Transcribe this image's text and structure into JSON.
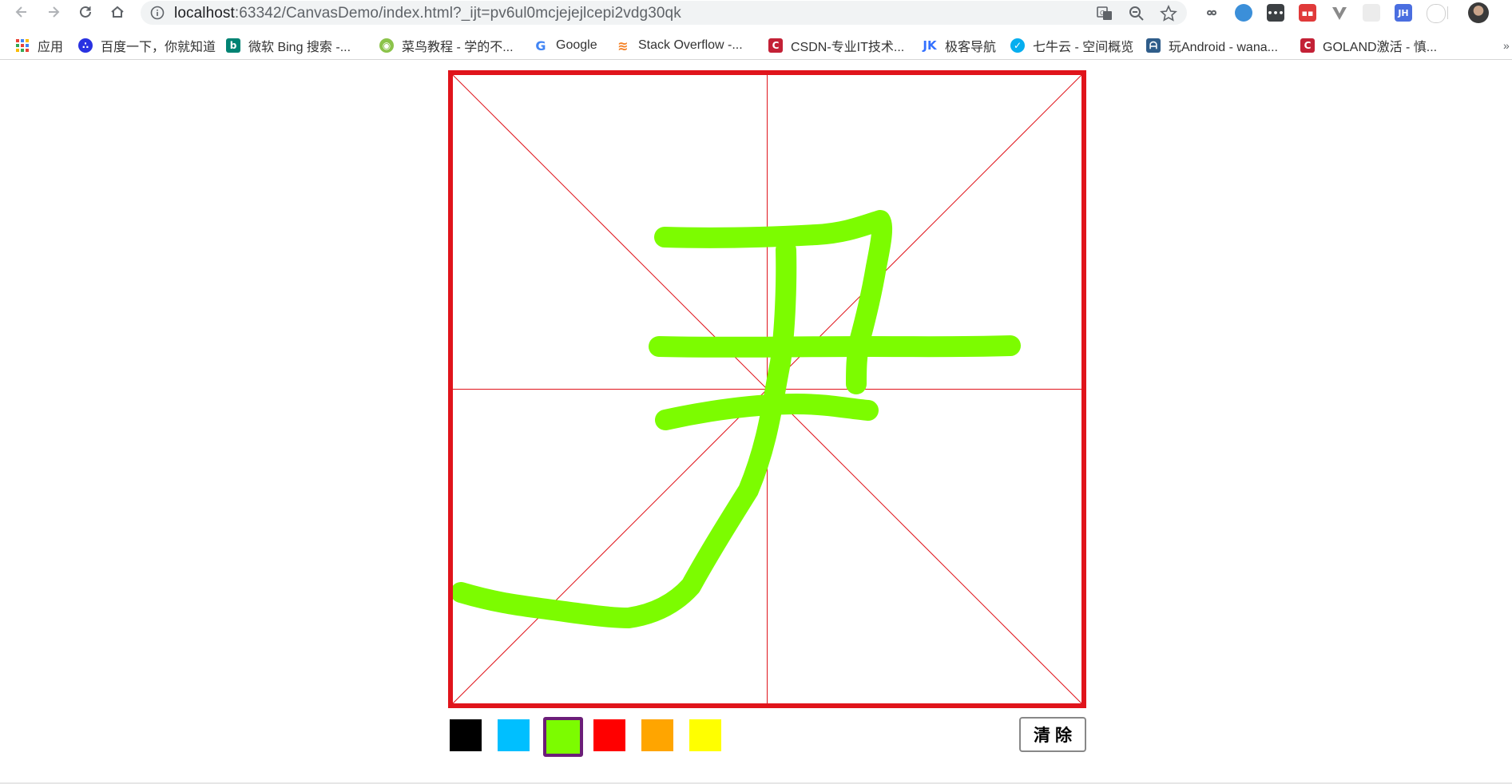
{
  "browser": {
    "url_host": "localhost",
    "url_rest": ":63342/CanvasDemo/index.html?_ijt=pv6ul0mcjejejlcepi2vdg30qk",
    "extensions": [
      {
        "name": "translate-icon"
      },
      {
        "name": "zoom-icon"
      },
      {
        "name": "bookmark-star-icon"
      },
      {
        "name": "infinity-extension-icon",
        "color": "#5f6368"
      },
      {
        "name": "wappalyzer-extension-icon",
        "color": "#3b8fd9"
      },
      {
        "name": "more-dots-extension-icon",
        "color": "#3c4043"
      },
      {
        "name": "red-extension-icon",
        "color": "#e03a3a"
      },
      {
        "name": "vue-extension-icon",
        "color": "#8a8a8a"
      },
      {
        "name": "blank-extension-icon",
        "color": "#dcdcdc"
      },
      {
        "name": "jh-extension-icon",
        "label": "JH",
        "color": "#4a6ee0"
      },
      {
        "name": "circle-extension-icon",
        "color": "#cfcfcf"
      },
      {
        "name": "profile-avatar",
        "color": "#555555"
      }
    ]
  },
  "bookmarks": [
    {
      "label": "应用",
      "icon": "apps-grid-icon",
      "color": "#ea4335"
    },
    {
      "label": "百度一下，你就知道",
      "icon": "baidu-paw-icon",
      "color": "#2932e1"
    },
    {
      "label": "微软 Bing 搜索 -...",
      "icon": "bing-icon",
      "color": "#008373"
    },
    {
      "label": "菜鸟教程 - 学的不...",
      "icon": "runoob-icon",
      "color": "#8bc34a"
    },
    {
      "label": "Google",
      "icon": "google-icon",
      "color": "#4285f4"
    },
    {
      "label": "Stack Overflow -...",
      "icon": "stackoverflow-icon",
      "color": "#f48024"
    },
    {
      "label": "CSDN-专业IT技术...",
      "icon": "csdn-icon",
      "color": "#c32136"
    },
    {
      "label": "极客导航",
      "icon": "jike-icon",
      "color": "#3370ff"
    },
    {
      "label": "七牛云 - 空间概览",
      "icon": "qiniu-icon",
      "color": "#06aeef"
    },
    {
      "label": "玩Android - wana...",
      "icon": "android-icon",
      "color": "#2f5d8a"
    },
    {
      "label": "GOLAND激活 - 慎...",
      "icon": "csdn-icon",
      "color": "#c32136"
    }
  ],
  "board": {
    "border_color": "#e0141b",
    "guide_color": "#e0141b",
    "stroke_color": "#7cfc00"
  },
  "palette": [
    {
      "name": "color-black",
      "color": "#000000",
      "selected": false
    },
    {
      "name": "color-blue",
      "color": "#00bfff",
      "selected": false
    },
    {
      "name": "color-green",
      "color": "#7cfc00",
      "selected": true
    },
    {
      "name": "color-red",
      "color": "#ff0000",
      "selected": false
    },
    {
      "name": "color-orange",
      "color": "#ffa500",
      "selected": false
    },
    {
      "name": "color-yellow",
      "color": "#ffff00",
      "selected": false
    }
  ],
  "clear_label": "清除"
}
